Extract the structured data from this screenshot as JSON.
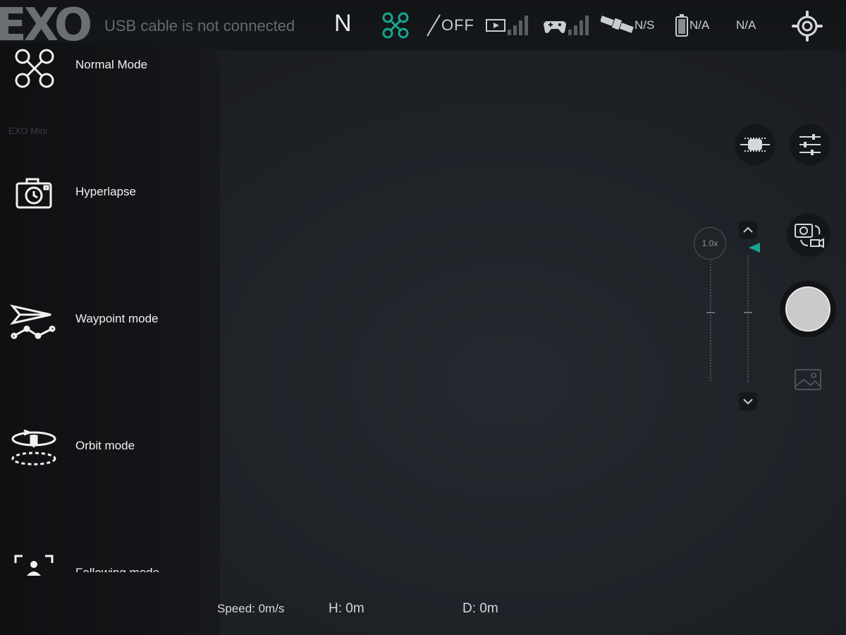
{
  "app": {
    "brand": "EXO",
    "brand_sub": "EXO Mini"
  },
  "status_bar": {
    "usb_status": "USB cable is not connected",
    "compass": "N",
    "obstacle_avoidance": "OFF",
    "satellite": "N/S",
    "battery": "N/A",
    "extra": "N/A",
    "accent_color": "#19a58e"
  },
  "modes": [
    {
      "label": "Normal Mode",
      "icon": "drone-x-icon"
    },
    {
      "label": "Hyperlapse",
      "icon": "camera-timer-icon"
    },
    {
      "label": "Waypoint mode",
      "icon": "waypoint-paper-plane-icon"
    },
    {
      "label": "Orbit mode",
      "icon": "orbit-icon"
    },
    {
      "label": "Following mode",
      "icon": "follow-frame-icon"
    }
  ],
  "telemetry": {
    "speed": "Speed: 0m/s",
    "height": "H: 0m",
    "distance": "D: 0m"
  },
  "camera": {
    "zoom": "1.0x"
  }
}
